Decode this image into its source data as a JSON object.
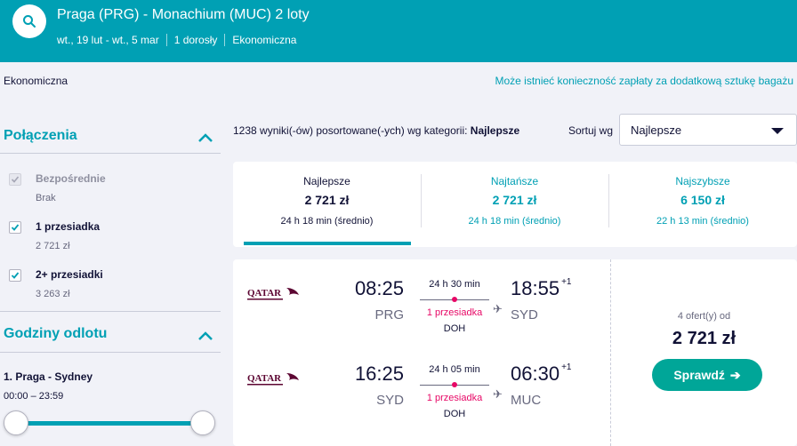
{
  "header": {
    "title": "Praga (PRG) - Monachium (MUC) 2 loty",
    "dates": "wt., 19 lut - wt., 5 mar",
    "passengers": "1 dorosły",
    "cabin": "Ekonomiczna"
  },
  "topbar": {
    "cabin_label": "Ekonomiczna",
    "bag_notice": "Może istnieć konieczność zapłaty za dodatkową sztukę bagażu"
  },
  "sidebar": {
    "connections_title": "Połączenia",
    "filters": [
      {
        "label": "Bezpośrednie",
        "price": "Brak",
        "checked": true,
        "disabled": true
      },
      {
        "label": "1 przesiadka",
        "price": "2 721 zł",
        "checked": true,
        "disabled": false
      },
      {
        "label": "2+ przesiadki",
        "price": "3 263 zł",
        "checked": true,
        "disabled": false
      }
    ],
    "departure_title": "Godziny odlotu",
    "departure_route": "1. Praga - Sydney",
    "departure_range": "00:00 – 23:59"
  },
  "results": {
    "count_text": "1238 wyniki(-ów) posortowane(-ych) wg kategorii: ",
    "count_sort": "Najlepsze",
    "sort_label": "Sortuj wg",
    "sort_value": "Najlepsze"
  },
  "tabs": [
    {
      "name": "Najlepsze",
      "price": "2 721 zł",
      "duration": "24 h 18 min (średnio)",
      "active": true
    },
    {
      "name": "Najtańsze",
      "price": "2 721 zł",
      "duration": "24 h 18 min (średnio)",
      "active": false
    },
    {
      "name": "Najszybsze",
      "price": "6 150 zł",
      "duration": "22 h 13 min (średnio)",
      "active": false
    }
  ],
  "card": {
    "airline": "QATAR",
    "legs": [
      {
        "dep_time": "08:25",
        "dep_airport": "PRG",
        "duration": "24 h 30 min",
        "stops": "1 przesiadka",
        "via": "DOH",
        "arr_time": "18:55",
        "arr_offset": "+1",
        "arr_airport": "SYD"
      },
      {
        "dep_time": "16:25",
        "dep_airport": "SYD",
        "duration": "24 h 05 min",
        "stops": "1 przesiadka",
        "via": "DOH",
        "arr_time": "06:30",
        "arr_offset": "+1",
        "arr_airport": "MUC"
      }
    ],
    "offers": "4 ofert(y) od",
    "price": "2 721 zł",
    "cta": "Sprawdź"
  },
  "colors": {
    "brand": "#00a0b4",
    "cta": "#00a698",
    "stops": "#e70866"
  }
}
